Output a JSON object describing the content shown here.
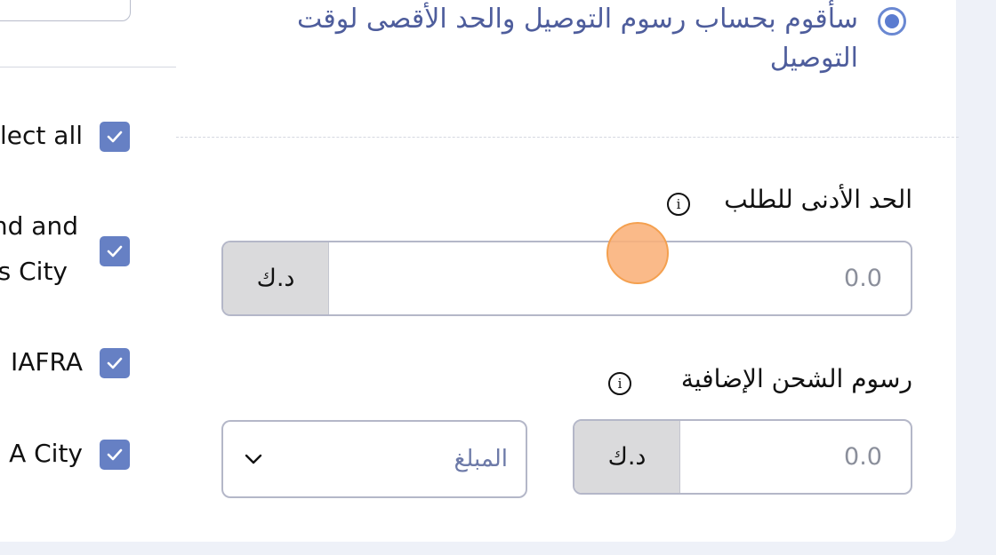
{
  "left_panel": {
    "items": [
      {
        "label": "lect all",
        "checked": true
      },
      {
        "label_line1": "nd and",
        "label_line2": "s City",
        "checked": true
      },
      {
        "label": "IAFRA",
        "checked": true
      },
      {
        "label": "A City",
        "checked": true
      }
    ]
  },
  "delivery_option": {
    "label": "سأقوم بحساب رسوم التوصيل والحد الأقصى لوقت التوصيل",
    "selected": true
  },
  "min_order": {
    "label": "الحد الأدنى للطلب",
    "currency": "د.ك",
    "placeholder": "0.0",
    "info_icon": "info-icon"
  },
  "extra_shipping": {
    "label": "رسوم الشحن الإضافية",
    "currency": "د.ك",
    "placeholder": "0.0",
    "type_select": "المبلغ",
    "info_icon": "info-icon"
  },
  "colors": {
    "accent": "#6680c4",
    "radio": "#5b7cd0",
    "touch": "#f9b079"
  }
}
